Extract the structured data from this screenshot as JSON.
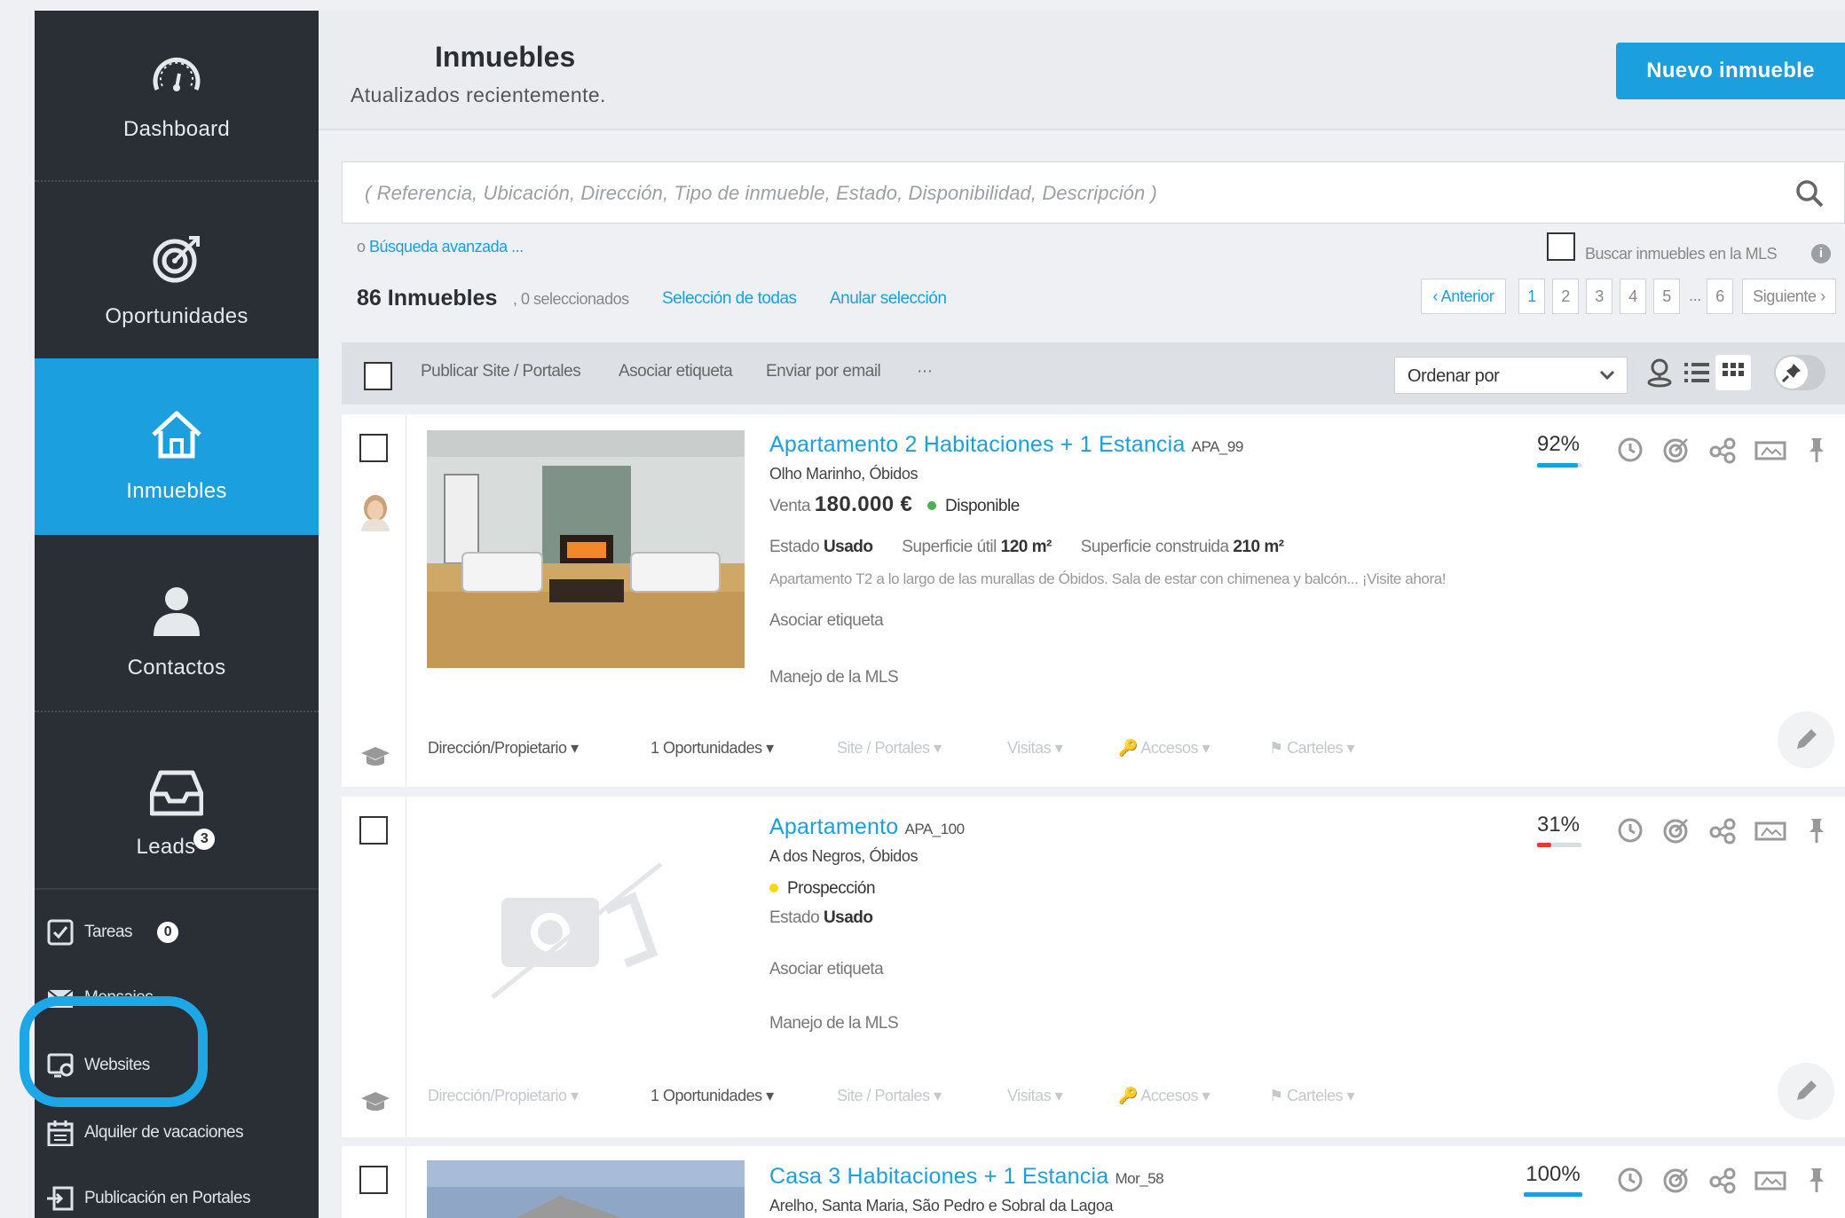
{
  "sidebar": {
    "nav": [
      {
        "label": "Dashboard",
        "icon": "gauge-icon"
      },
      {
        "label": "Oportunidades",
        "icon": "target-icon"
      },
      {
        "label": "Inmuebles",
        "icon": "house-icon"
      },
      {
        "label": "Contactos",
        "icon": "person-icon"
      },
      {
        "label": "Leads",
        "icon": "inbox-icon",
        "badge": "3"
      }
    ],
    "sub": [
      {
        "label": "Tareas",
        "icon": "checkbox-icon",
        "badge": "0"
      },
      {
        "label": "Mensajes",
        "icon": "envelope-icon"
      },
      {
        "label": "Websites",
        "icon": "website-gear-icon"
      },
      {
        "label": "Alquiler de vacaciones",
        "icon": "calendar-icon"
      },
      {
        "label": "Publicación en Portales",
        "icon": "publish-icon"
      }
    ]
  },
  "header": {
    "title": "Inmuebles",
    "subtitle": "Atualizados recientemente.",
    "new_button": "Nuevo inmueble"
  },
  "search": {
    "placeholder": "( Referencia, Ubicación, Dirección, Tipo de inmueble, Estado, Disponibilidad, Descripción )",
    "advanced_prefix": "o",
    "advanced_link": "Búsqueda avanzada ...",
    "mls_label": "Buscar inmuebles en la MLS",
    "mls_info": "i"
  },
  "summary": {
    "count": "86 Inmuebles",
    "selected": ", 0 seleccionados",
    "select_all": "Selección de todas",
    "deselect": "Anular selección"
  },
  "pagination": {
    "prev": "‹ Anterior",
    "pages": [
      "1",
      "2",
      "3",
      "4",
      "5"
    ],
    "ellipsis": "...",
    "last": "6",
    "next": "Siguiente ›"
  },
  "toolbar": {
    "actions": [
      "Publicar Site / Portales",
      "Asociar etiqueta",
      "Enviar por email",
      "···"
    ],
    "sort_label": "Ordenar por"
  },
  "properties": [
    {
      "title": "Apartamento 2 Habitaciones + 1 Estancia",
      "ref": "APA_99",
      "location": "Olho Marinho, Óbidos",
      "operation": "Venta",
      "price": "180.000 €",
      "status": "Disponible",
      "status_color": "#4caf50",
      "estado_label": "Estado",
      "estado_value": "Usado",
      "util_label": "Superficie útil",
      "util_value": "120 m²",
      "built_label": "Superficie construida",
      "built_value": "210 m²",
      "description": "Apartamento T2 a lo largo de las murallas de Óbidos. Sala de estar con chimenea y balcón... ¡Visite ahora!",
      "tag_link": "Asociar etiqueta",
      "mls_link": "Manejo de la MLS",
      "completeness": "92%",
      "completeness_value": 0.92,
      "bar_color": "#1b9fde",
      "footer": [
        "Dirección/Propietario",
        "1 Oportunidades",
        "Site / Portales",
        "Visitas",
        "Accesos",
        "Carteles"
      ]
    },
    {
      "title": "Apartamento",
      "ref": "APA_100",
      "location": "A dos Negros, Óbidos",
      "status": "Prospección",
      "status_color": "#f5d800",
      "estado_label": "Estado",
      "estado_value": "Usado",
      "tag_link": "Asociar etiqueta",
      "mls_link": "Manejo de la MLS",
      "completeness": "31%",
      "completeness_value": 0.31,
      "bar_color": "#e53935",
      "footer": [
        "Dirección/Propietario",
        "1 Oportunidades",
        "Site / Portales",
        "Visitas",
        "Accesos",
        "Carteles"
      ]
    },
    {
      "title": "Casa 3 Habitaciones + 1 Estancia",
      "ref": "Mor_58",
      "location": "Arelho, Santa Maria, São Pedro e Sobral da Lagoa",
      "completeness": "100%",
      "completeness_value": 1.0,
      "bar_color": "#1b9fde"
    }
  ]
}
